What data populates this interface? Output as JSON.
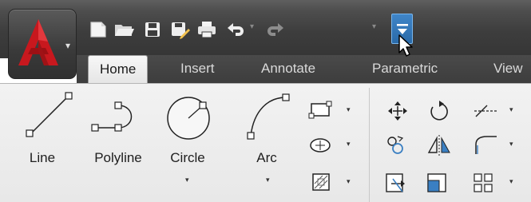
{
  "window": {
    "app_menu": {
      "logo": "autocad-a-logo",
      "dropdown": "dropdown-arrow-icon"
    },
    "quick_access": [
      {
        "icon": "new-document-icon"
      },
      {
        "icon": "open-folder-icon"
      },
      {
        "icon": "save-icon"
      },
      {
        "icon": "save-as-icon"
      },
      {
        "icon": "print-icon"
      },
      {
        "icon": "undo-icon"
      },
      {
        "icon": "redo-icon"
      },
      {
        "icon": "customize-quick-access-icon"
      }
    ]
  },
  "tabs": [
    {
      "label": "Home",
      "active": true
    },
    {
      "label": "Insert",
      "active": false
    },
    {
      "label": "Annotate",
      "active": false
    },
    {
      "label": "Parametric",
      "active": false
    },
    {
      "label": "View",
      "active": false
    }
  ],
  "draw_panel": {
    "tools": [
      {
        "label": "Line",
        "icon": "line-icon"
      },
      {
        "label": "Polyline",
        "icon": "polyline-icon"
      },
      {
        "label": "Circle",
        "icon": "circle-icon",
        "has_dropdown": true
      },
      {
        "label": "Arc",
        "icon": "arc-icon",
        "has_dropdown": true
      }
    ],
    "small_tools": [
      {
        "icon": "rectangle-icon"
      },
      {
        "icon": "ellipse-icon"
      },
      {
        "icon": "hatch-icon"
      }
    ]
  },
  "modify_panel": {
    "small_tools": [
      {
        "icon": "move-icon"
      },
      {
        "icon": "rotate-icon"
      },
      {
        "icon": "trim-icon"
      },
      {
        "icon": "copy-icon"
      },
      {
        "icon": "mirror-icon"
      },
      {
        "icon": "fillet-icon"
      },
      {
        "icon": "stretch-icon"
      },
      {
        "icon": "scale-icon"
      },
      {
        "icon": "array-icon"
      }
    ]
  },
  "colors": {
    "logo_red": "#c8181e",
    "accent_blue": "#3a7fc2",
    "ribbon_bg": "#efefef",
    "titlebar_bg": "#3d3d3d"
  }
}
